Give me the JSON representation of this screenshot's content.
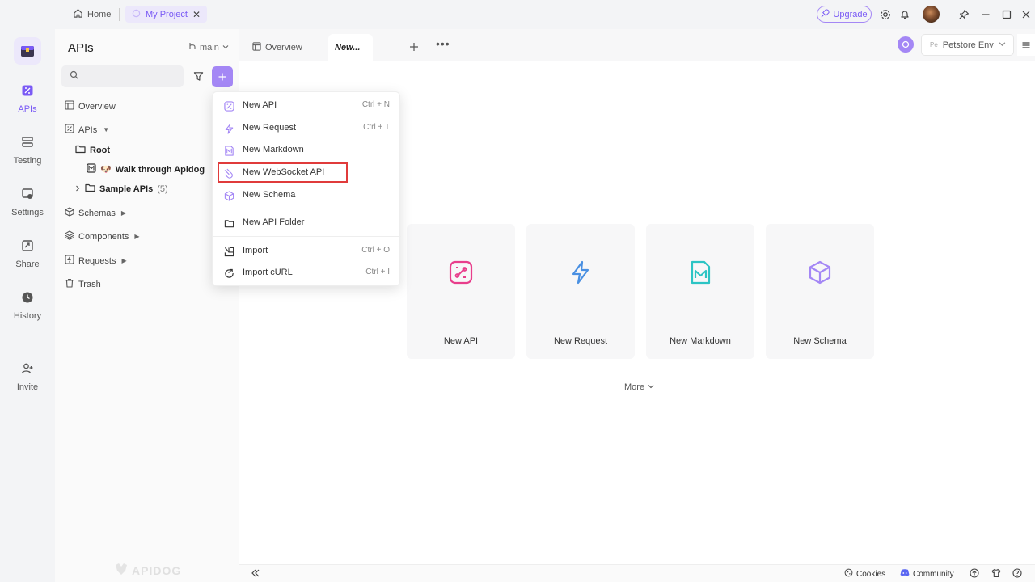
{
  "titlebar": {
    "home_label": "Home",
    "project_tab": "My Project",
    "project_close": "✕",
    "upgrade_label": "Upgrade"
  },
  "rail": {
    "items": [
      {
        "label": "APIs"
      },
      {
        "label": "Testing"
      },
      {
        "label": "Settings"
      },
      {
        "label": "Share"
      },
      {
        "label": "History"
      },
      {
        "label": "Invite"
      }
    ]
  },
  "sidebar": {
    "title": "APIs",
    "branch": "main",
    "search_placeholder": "",
    "tree": {
      "overview": "Overview",
      "apis": "APIs",
      "root": "Root",
      "walk_emoji": "🐶",
      "walk": "Walk through Apidog",
      "sample": "Sample APIs",
      "sample_count": "(5)",
      "schemas": "Schemas",
      "components": "Components",
      "requests": "Requests",
      "trash": "Trash"
    },
    "watermark": "APIDOG"
  },
  "tabs": {
    "overview": "Overview",
    "new": "New...",
    "more": "•••"
  },
  "env": {
    "badge": "Pe",
    "name": "Petstore Env"
  },
  "dropdown": {
    "items": [
      {
        "label": "New API",
        "shortcut": "Ctrl + N"
      },
      {
        "label": "New Request",
        "shortcut": "Ctrl + T"
      },
      {
        "label": "New Markdown",
        "shortcut": ""
      },
      {
        "label": "New WebSocket API",
        "shortcut": ""
      },
      {
        "label": "New Schema",
        "shortcut": ""
      },
      {
        "label": "New API Folder",
        "shortcut": ""
      },
      {
        "label": "Import",
        "shortcut": "Ctrl + O"
      },
      {
        "label": "Import cURL",
        "shortcut": "Ctrl + I"
      }
    ]
  },
  "cards": [
    {
      "label": "New API",
      "color": "#e83e8c"
    },
    {
      "label": "New Request",
      "color": "#4a90e2"
    },
    {
      "label": "New Markdown",
      "color": "#2cc4c4"
    },
    {
      "label": "New Schema",
      "color": "#a487f5"
    }
  ],
  "more_label": "More",
  "bottombar": {
    "cookies": "Cookies",
    "community": "Community"
  },
  "colors": {
    "accent": "#a487f5",
    "accent_dark": "#7a5af5",
    "highlight": "#e03b3b"
  }
}
